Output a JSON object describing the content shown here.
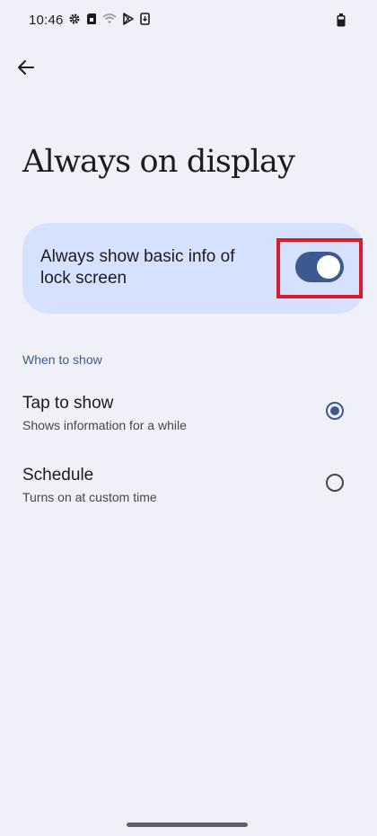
{
  "status_bar": {
    "time": "10:46",
    "icons": [
      "settings-icon",
      "sim-icon",
      "wifi-icon",
      "play-store-icon",
      "download-icon"
    ],
    "battery_icon": "battery-icon"
  },
  "header": {
    "back_icon": "arrow-back-icon",
    "title": "Always on display"
  },
  "main_toggle": {
    "label": "Always show basic info of lock screen",
    "enabled": true
  },
  "when_to_show": {
    "header": "When to show",
    "options": [
      {
        "title": "Tap to show",
        "subtitle": "Shows information for a while",
        "selected": true
      },
      {
        "title": "Schedule",
        "subtitle": "Turns on at custom time",
        "selected": false
      }
    ]
  },
  "colors": {
    "background": "#f0f1f8",
    "card": "#d6e2fd",
    "accent": "#3c5a8f",
    "highlight": "#d41d2d"
  }
}
